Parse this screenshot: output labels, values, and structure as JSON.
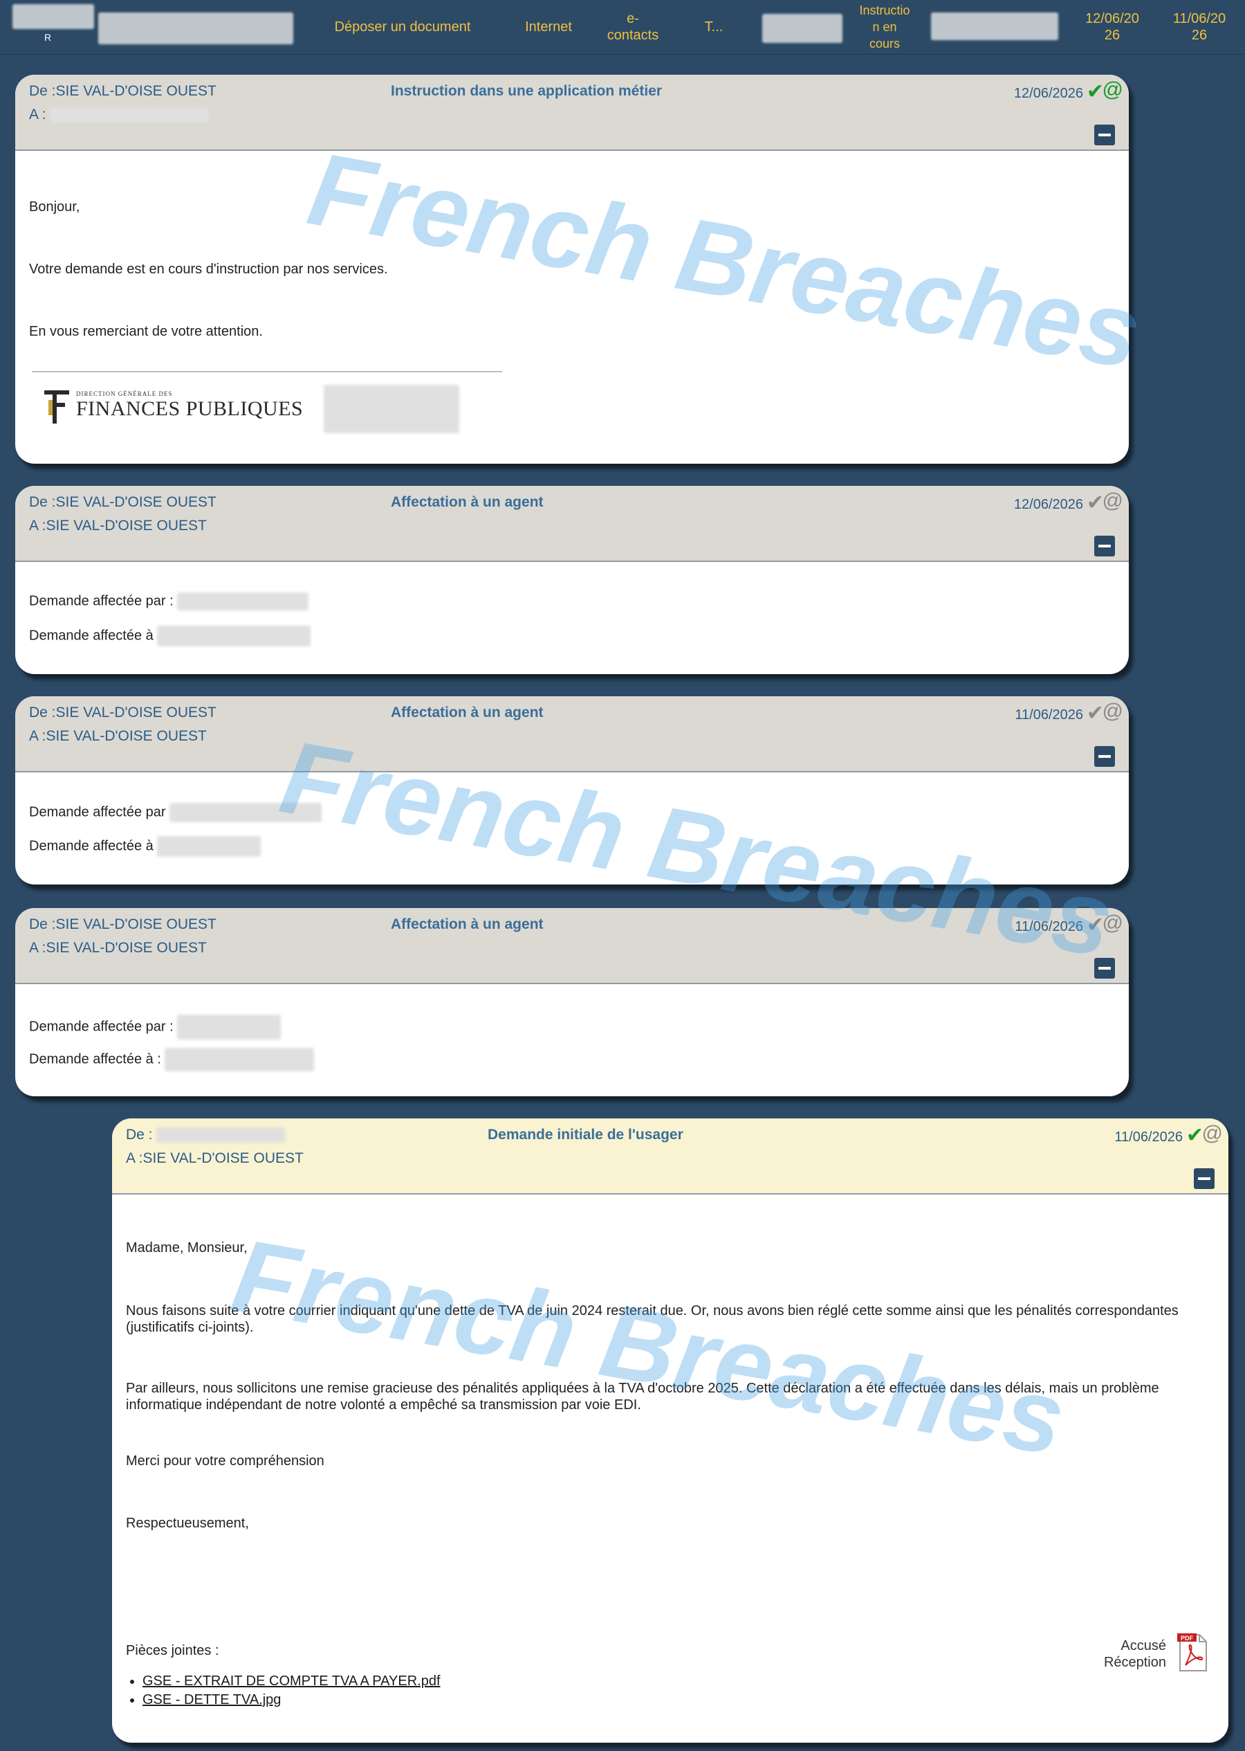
{
  "topbar": {
    "user_initial": "R",
    "deposit_label": "Déposer un document",
    "channel_label": "Internet",
    "econtacts_label": "e-\ncontacts",
    "truncated_label": "T...",
    "status_label": "Instructio\nn en\ncours",
    "date1_label": "12/06/20\n26",
    "date2_label": "11/06/20\n26"
  },
  "messages": [
    {
      "from": "De :SIE VAL-D'OISE OUEST",
      "to": "A :",
      "title": "Instruction dans une application métier",
      "date": "12/06/2026",
      "check": "✔",
      "at": "@",
      "lines": [
        "Bonjour,",
        "Votre demande est en cours d'instruction par nos services.",
        "En vous remerciant de votre attention."
      ],
      "logo_small": "DIRECTION GÉNÉRALE DES",
      "logo_big": "FINANCES PUBLIQUES"
    },
    {
      "from": "De :SIE VAL-D'OISE OUEST",
      "to": "A :SIE VAL-D'OISE OUEST",
      "title": "Affectation à un agent",
      "date": "12/06/2026",
      "check": "✔",
      "at": "@",
      "line1": "Demande affectée par :",
      "line2": "Demande affectée à"
    },
    {
      "from": "De :SIE VAL-D'OISE OUEST",
      "to": "A :SIE VAL-D'OISE OUEST",
      "title": "Affectation à un agent",
      "date": "11/06/2026",
      "check": "✔",
      "at": "@",
      "line1": "Demande affectée par",
      "line2": "Demande affectée à"
    },
    {
      "from": "De :SIE VAL-D'OISE OUEST",
      "to": "A :SIE VAL-D'OISE OUEST",
      "title": "Affectation à un agent",
      "date": "11/06/2026",
      "check": "✔",
      "at": "@",
      "line1": "Demande affectée par :",
      "line2": "Demande affectée à :"
    },
    {
      "from": "De :",
      "to": "A :SIE VAL-D'OISE OUEST",
      "title": "Demande initiale de l'usager",
      "date": "11/06/2026",
      "check": "✔",
      "at": "@",
      "salutation": "Madame, Monsieur,",
      "para1": "Nous faisons suite à votre courrier indiquant qu'une dette de TVA de juin 2024 resterait due. Or, nous avons bien réglé cette somme ainsi que les pénalités correspondantes (justificatifs ci-joints).",
      "para2": "Par ailleurs, nous sollicitons une remise gracieuse des pénalités appliquées à la TVA d'octobre 2025. Cette déclaration a été effectuée dans les délais, mais un problème informatique indépendant de notre volonté a empêché sa transmission par voie EDI.",
      "thanks": "Merci pour votre compréhension",
      "closing": "Respectueusement,",
      "attachments_label": "Pièces jointes :",
      "attachments": [
        "GSE - EXTRAIT DE COMPTE TVA A PAYER.pdf",
        "GSE - DETTE TVA.jpg"
      ],
      "receipt_label": "Accusé\nRéception",
      "pdf_badge": "PDF"
    }
  ],
  "watermark": {
    "part1": "French",
    "part2": "Breaches"
  },
  "colors": {
    "background": "#2c4a66",
    "topbar_text": "#f0c040",
    "header_grey": "#dcd9d3",
    "header_initial": "#faf3d2",
    "check_green": "#1c9a2c",
    "check_grey": "#8a8a8a",
    "watermark_blue": "#46a0e6"
  }
}
